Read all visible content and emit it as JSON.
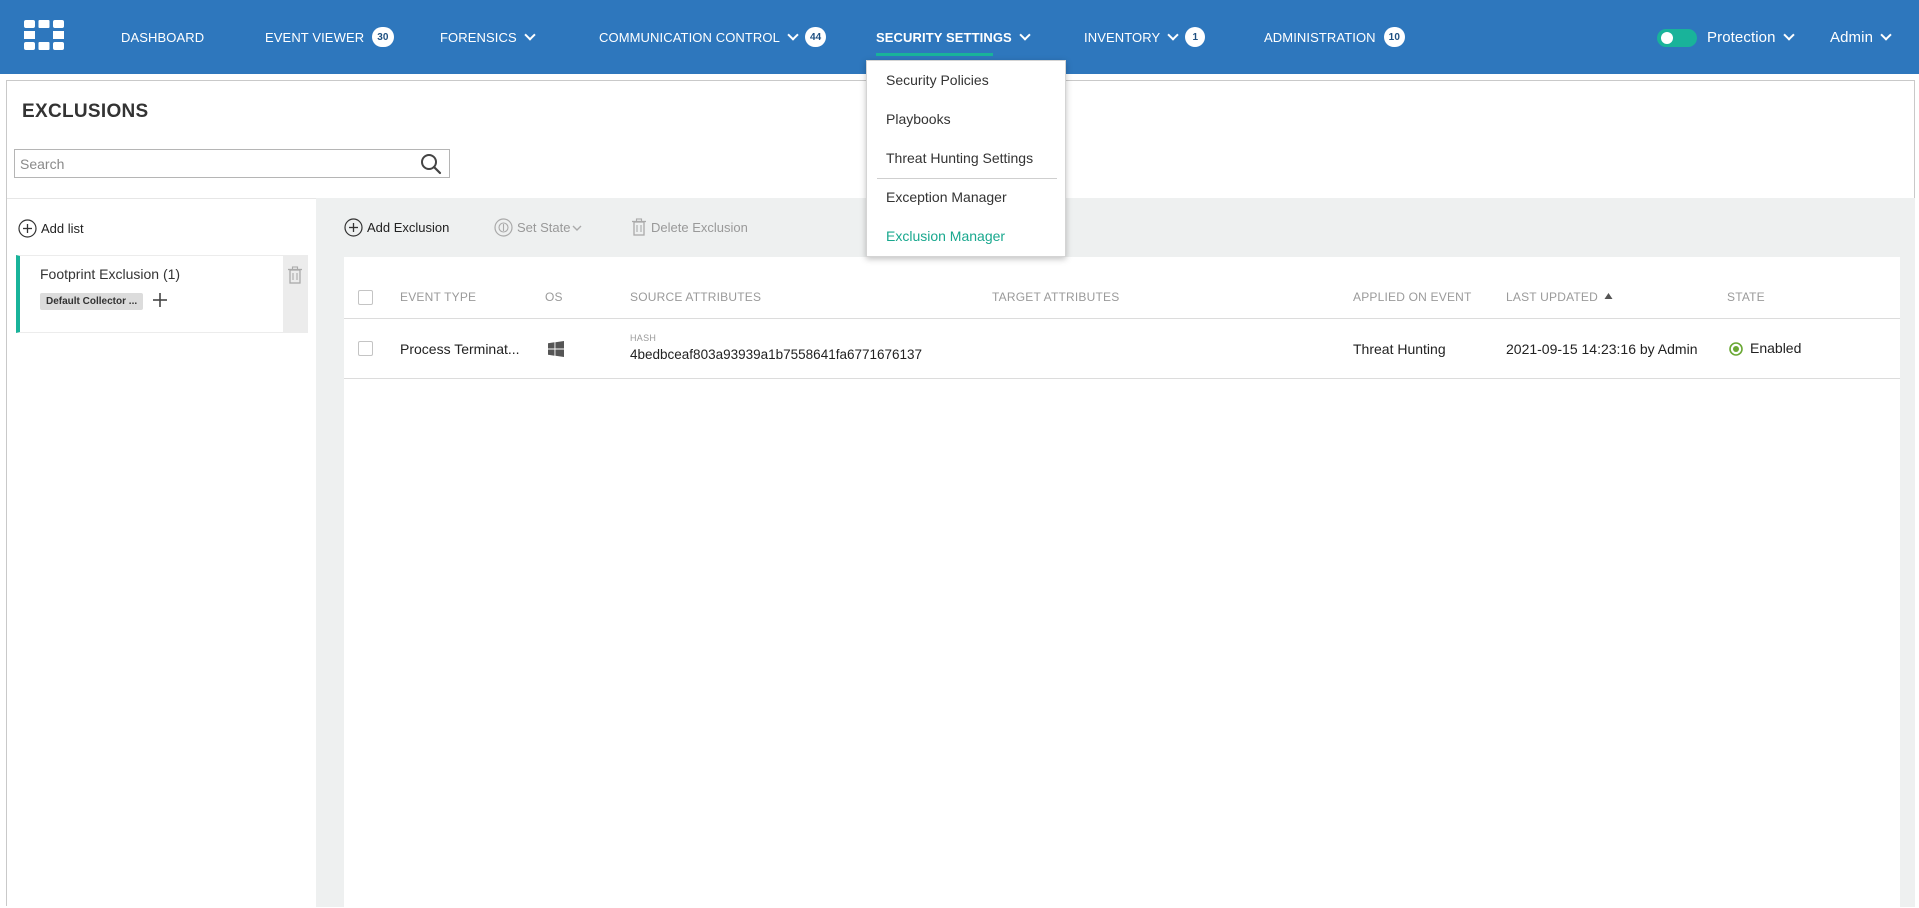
{
  "nav": {
    "items": [
      {
        "label": "DASHBOARD"
      },
      {
        "label": "EVENT VIEWER",
        "badge": "30"
      },
      {
        "label": "FORENSICS"
      },
      {
        "label": "COMMUNICATION CONTROL",
        "badge": "44"
      },
      {
        "label": "SECURITY SETTINGS"
      },
      {
        "label": "INVENTORY",
        "badge": "1"
      },
      {
        "label": "ADMINISTRATION",
        "badge": "10"
      }
    ],
    "protection_label": "Protection",
    "user_label": "Admin"
  },
  "dropdown": {
    "items": [
      {
        "label": "Security Policies"
      },
      {
        "label": "Playbooks"
      },
      {
        "label": "Threat Hunting Settings"
      },
      {
        "label": "Exception Manager"
      },
      {
        "label": "Exclusion Manager"
      }
    ]
  },
  "page": {
    "title": "EXCLUSIONS",
    "search_placeholder": "Search"
  },
  "left": {
    "add_list_label": "Add list",
    "lists": [
      {
        "name": "Footprint Exclusion (1)",
        "collector": "Default Collector ..."
      }
    ]
  },
  "toolbar": {
    "add_exclusion": "Add Exclusion",
    "set_state": "Set State",
    "delete_exclusion": "Delete Exclusion"
  },
  "table": {
    "headers": {
      "event_type": "EVENT TYPE",
      "os": "OS",
      "source": "SOURCE ATTRIBUTES",
      "target": "TARGET ATTRIBUTES",
      "applied": "APPLIED ON EVENT",
      "updated": "LAST UPDATED",
      "state": "STATE"
    },
    "rows": [
      {
        "event_type": "Process Terminat...",
        "os_icon": "windows-icon",
        "source_label": "HASH",
        "source_value": "4bedbceaf803a93939a1b7558641fa6771676137",
        "target": "",
        "applied": "Threat Hunting",
        "updated": "2021-09-15 14:23:16 by Admin",
        "state": "Enabled"
      }
    ]
  },
  "colors": {
    "header_bg": "#2e77bd",
    "accent": "#19b39a",
    "enabled": "#6aa834"
  }
}
